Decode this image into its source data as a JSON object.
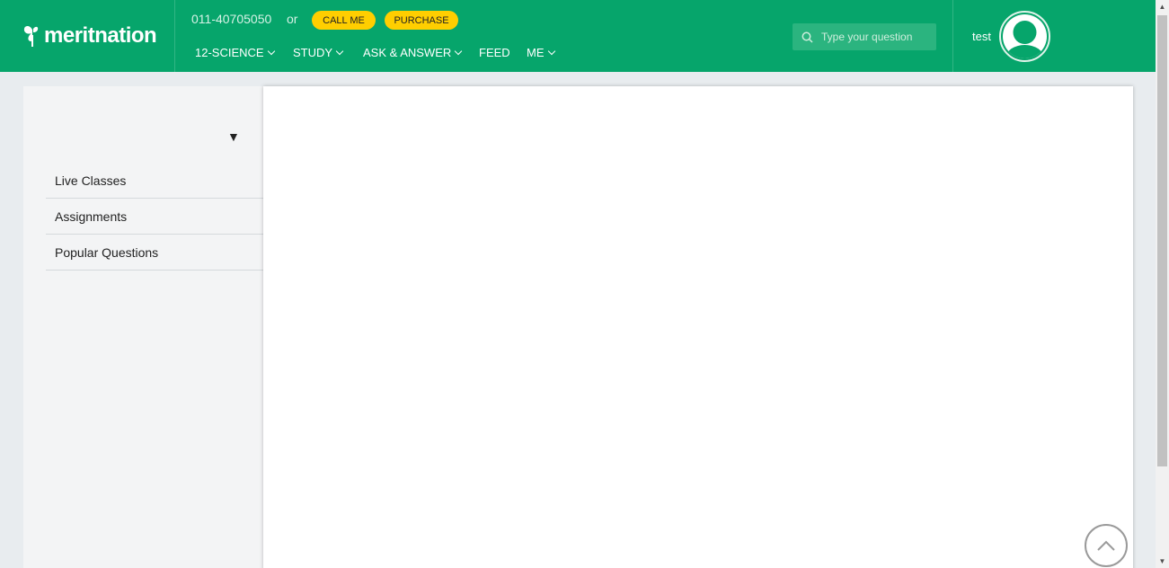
{
  "header": {
    "logo_text": "meritnation",
    "phone": "011-40705050",
    "or_text": "or",
    "call_me_label": "CALL ME",
    "purchase_label": "PURCHASE",
    "nav": {
      "grade": "12-SCIENCE",
      "study": "STUDY",
      "ask_answer": "ASK & ANSWER",
      "feed": "FEED",
      "me": "ME"
    },
    "search_placeholder": "Type your question",
    "username": "test"
  },
  "sidebar": {
    "items": [
      {
        "label": "Live Classes"
      },
      {
        "label": "Assignments"
      },
      {
        "label": "Popular Questions"
      }
    ]
  },
  "colors": {
    "brand_green": "#06a56b",
    "button_yellow": "#ffce00"
  },
  "icons": {
    "logo": "butterfly-icon",
    "search": "search-icon",
    "avatar": "user-avatar-icon",
    "dropdown": "caret-down-icon",
    "back_to_top": "chevron-up-icon"
  }
}
